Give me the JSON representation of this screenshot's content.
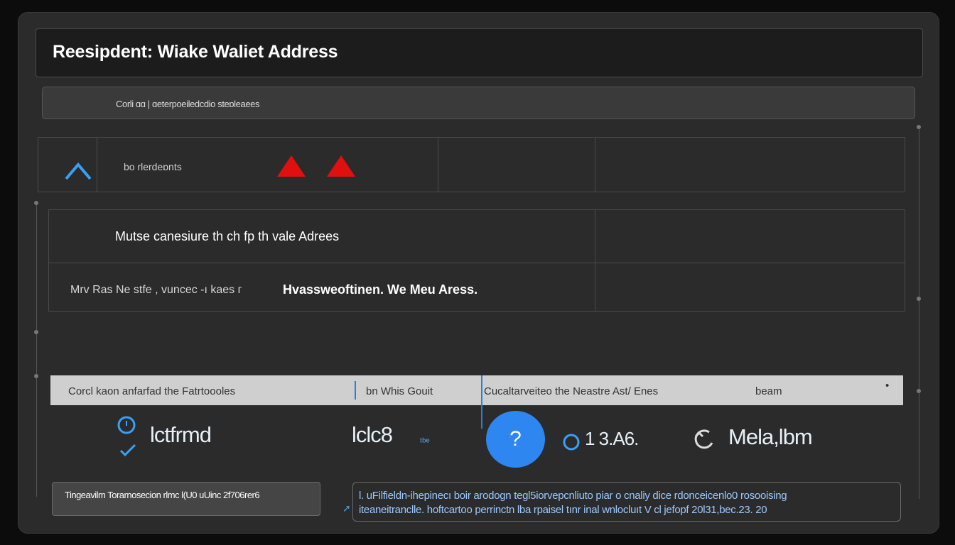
{
  "window": {
    "title": "Reesipdent: Wiake Waliet Address"
  },
  "search": {
    "text": "Corli ɑɑ  |  ɑeterpoeiledcdio steɒleaees"
  },
  "table1": {
    "label": "bo rlerdeɒnts"
  },
  "table2": {
    "row1": "Mutse canesiure th ch fp th vale Adrees",
    "row2_left": "Mrv Ras Ne stfe , vuncec  -ı kaes  ᴦ",
    "row2_right": "Hvassweoftinen. We Meu Aress."
  },
  "stripe": {
    "left": "Corcl kaon anfarfad the Fatrtoooles",
    "mid": "bn Whis Gouit",
    "right": "Cucaltarveiteo the Neastre Ast/ Enes",
    "far": "beam"
  },
  "stats": {
    "s1": "lctfrmd",
    "s2": "lclc8",
    "s2_suffix": "ᵗᵇᵉ",
    "s3": "1 3.A6.",
    "s4": "Mela,lbm"
  },
  "help": {
    "glyph": "?"
  },
  "notes": {
    "left": "Tingeavilm Torarnosecion rlmc l(U0 uUinc 2f706rer6",
    "right_line1": "l. uFilfieldn-ihepinecı boir  arodogn tegl5iorvepcnliuto piar o cnaliy dice  rdonceicenlo0 rosooising",
    "right_line2": "iteaneitranclle.  hoftcartoo  perrinctn lba rpaisel  tınr inal wnlocluıt V cl  jefopf 20l31,bec.23. 20"
  },
  "colors": {
    "accent": "#2e86f0",
    "warning": "#e11010",
    "background": "#2b2b2b"
  }
}
